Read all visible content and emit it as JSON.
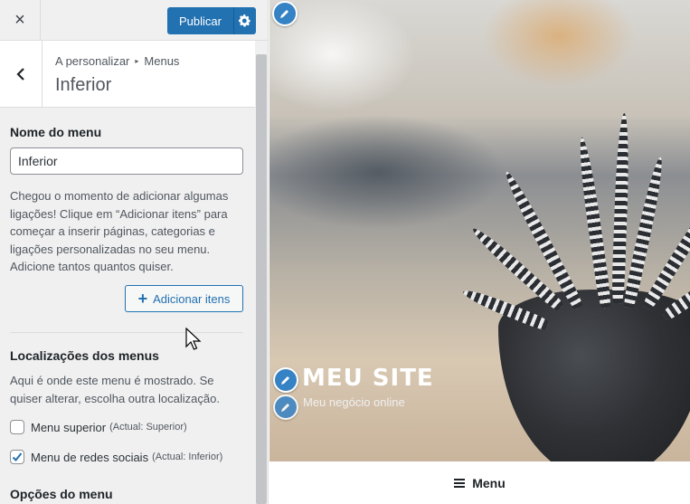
{
  "topbar": {
    "close_icon": "×",
    "publish_label": "Publicar",
    "gear_icon": "gear-icon"
  },
  "section": {
    "breadcrumb_parent": "A personalizar",
    "breadcrumb_current": "Menus",
    "title": "Inferior"
  },
  "menu_name": {
    "label": "Nome do menu",
    "value": "Inferior"
  },
  "description": "Chegou o momento de adicionar algumas ligações! Clique em “Adicionar itens” para começar a inserir páginas, categorias e ligações personalizadas no seu menu. Adicione tantos quantos quiser.",
  "add_items_label": "Adicionar itens",
  "locations": {
    "title": "Localizações dos menus",
    "description": "Aqui é onde este menu é mostrado. Se quiser alterar, escolha outra localização.",
    "items": [
      {
        "label": "Menu superior",
        "note": "(Actual: Superior)",
        "checked": false
      },
      {
        "label": "Menu de redes sociais",
        "note": "(Actual: Inferior)",
        "checked": true
      }
    ]
  },
  "options_title": "Opções do menu",
  "preview": {
    "site_title": "MEU SITE",
    "site_tagline": "Meu negócio online",
    "menu_label": "Menu"
  },
  "colors": {
    "accent": "#2271b1",
    "pencil": "#3582c4"
  }
}
